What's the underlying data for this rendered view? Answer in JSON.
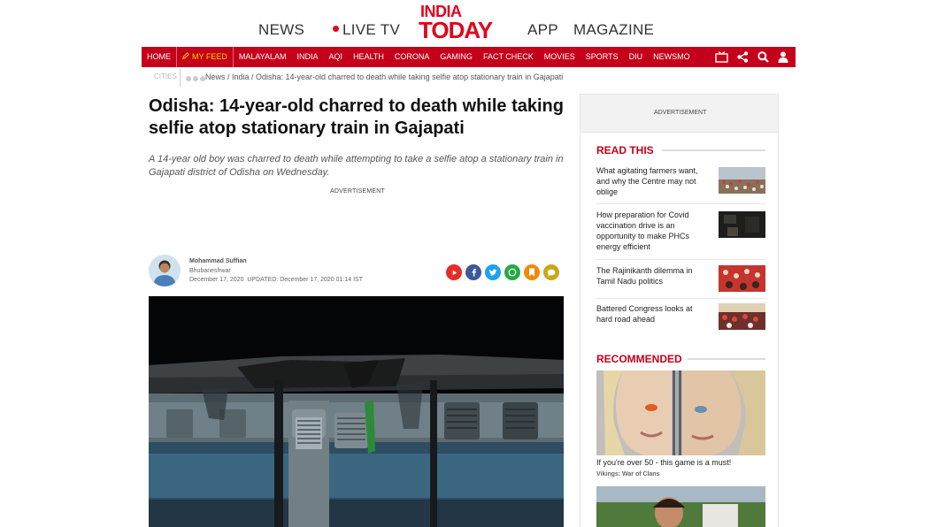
{
  "topnav": {
    "news": "NEWS",
    "live_tv": "LIVE TV",
    "app": "APP",
    "magazine": "MAGAZINE",
    "logo_line1": "INDIA",
    "logo_line2": "TODAY"
  },
  "rednav": {
    "items": [
      "HOME",
      "MY FEED",
      "MALAYALAM",
      "INDIA",
      "AQI",
      "HEALTH",
      "CORONA",
      "GAMING",
      "FACT CHECK",
      "MOVIES",
      "SPORTS",
      "DIU",
      "NEWSMO"
    ],
    "active_item": "MY FEED",
    "icons": [
      "tv-icon",
      "share-icon",
      "search-icon",
      "user-icon"
    ]
  },
  "subnav": {
    "cities": "CITIES",
    "breadcrumb": "News / India / Odisha: 14-year-old charred to death while taking selfie atop stationary train in Gajapati"
  },
  "article": {
    "title": "Odisha: 14-year-old charred to death while taking selfie atop stationary train in Gajapati",
    "summary": "A 14-year old boy was charred to death while attempting to take a selfie atop a stationary train in Gajapati district of Odisha on Wednesday.",
    "advertisement": "ADVERTISEMENT",
    "author_name": "Mohammad Suffian",
    "location": "Bhubaneshwar",
    "date": "December 17, 2020",
    "updated": "UPDATED: December 17, 2020 01:14 IST",
    "share_icons": [
      "youtube-icon",
      "facebook-icon",
      "twitter-icon",
      "whatsapp-icon",
      "bookmark-icon",
      "comment-icon"
    ]
  },
  "sidebar": {
    "advertisement": "ADVERTISEMENT",
    "read_this_title": "READ THIS",
    "read_this": [
      {
        "title": "What agitating farmers want, and why the Centre may not oblige"
      },
      {
        "title": "How preparation for Covid vaccination drive is an opportunity to make PHCs energy efficient"
      },
      {
        "title": "The Rajinikanth dilemma in Tamil Nadu politics"
      },
      {
        "title": "Battered Congress looks at hard road ahead"
      }
    ],
    "recommended_title": "RECOMMENDED",
    "recommended": [
      {
        "caption": "If you're over 50 - this game is a must!",
        "source": "Vikings: War of Clans"
      }
    ]
  },
  "colors": {
    "brand_red": "#c4001a",
    "active_nav": "#ffd400"
  }
}
